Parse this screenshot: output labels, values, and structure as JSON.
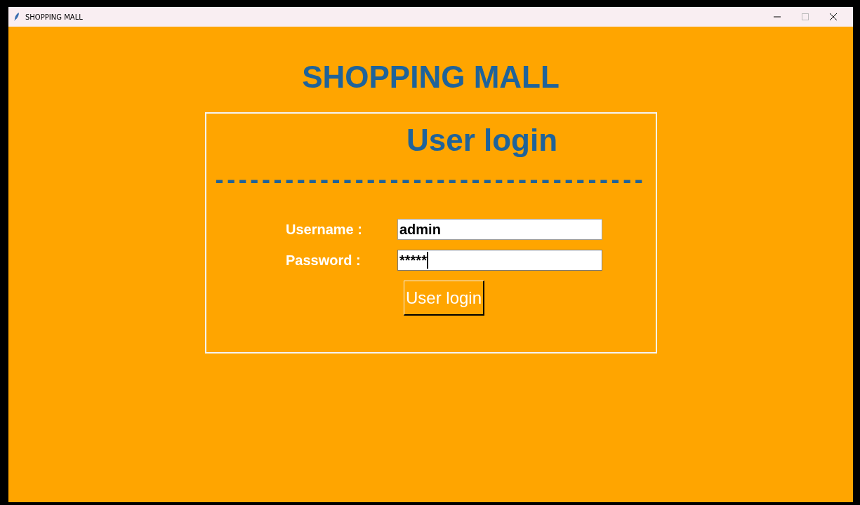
{
  "window": {
    "title": "SHOPPING MALL"
  },
  "heading": "SHOPPING MALL",
  "login_panel": {
    "title": "User login",
    "divider": "-------------------------------------",
    "fields": [
      {
        "label": "Username :",
        "value": "admin",
        "focused": false
      },
      {
        "label": "Password :",
        "value": "*****",
        "focused": true
      }
    ],
    "button": "User login"
  }
}
